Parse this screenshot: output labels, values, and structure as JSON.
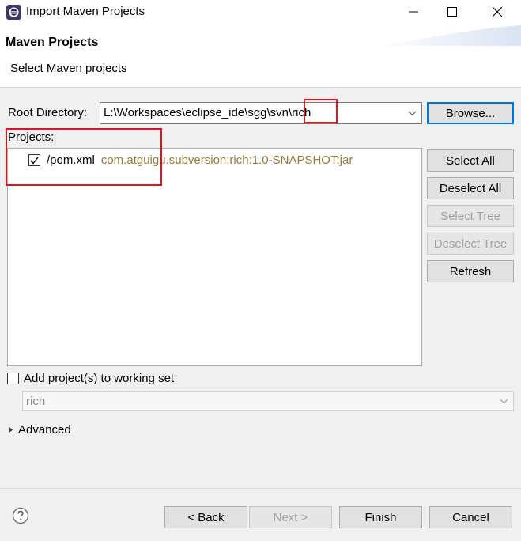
{
  "window": {
    "title": "Import Maven Projects",
    "app_icon": "eclipse-icon",
    "controls": [
      "minimize-icon",
      "maximize-icon",
      "close-icon"
    ]
  },
  "header": {
    "title": "Maven Projects",
    "subtitle": "Select Maven projects"
  },
  "root_directory": {
    "label": "Root Directory:",
    "value": "L:\\Workspaces\\eclipse_ide\\sgg\\svn\\rich",
    "browse_label": "Browse..."
  },
  "projects": {
    "label": "Projects:",
    "items": [
      {
        "checked": true,
        "path": "/pom.xml",
        "artifact": "com.atguigu.subversion:rich:1.0-SNAPSHOT:jar"
      }
    ],
    "buttons": {
      "select_all": "Select All",
      "deselect_all": "Deselect All",
      "select_tree": "Select Tree",
      "deselect_tree": "Deselect Tree",
      "refresh": "Refresh"
    }
  },
  "working_set": {
    "label": "Add project(s) to working set",
    "checked": false,
    "value": "rich"
  },
  "advanced": {
    "label": "Advanced"
  },
  "footer": {
    "back": "< Back",
    "next": "Next >",
    "finish": "Finish",
    "cancel": "Cancel"
  },
  "colors": {
    "accent": "#0078d7",
    "annotation": "#e0141e",
    "artifact_text": "#957b36"
  }
}
